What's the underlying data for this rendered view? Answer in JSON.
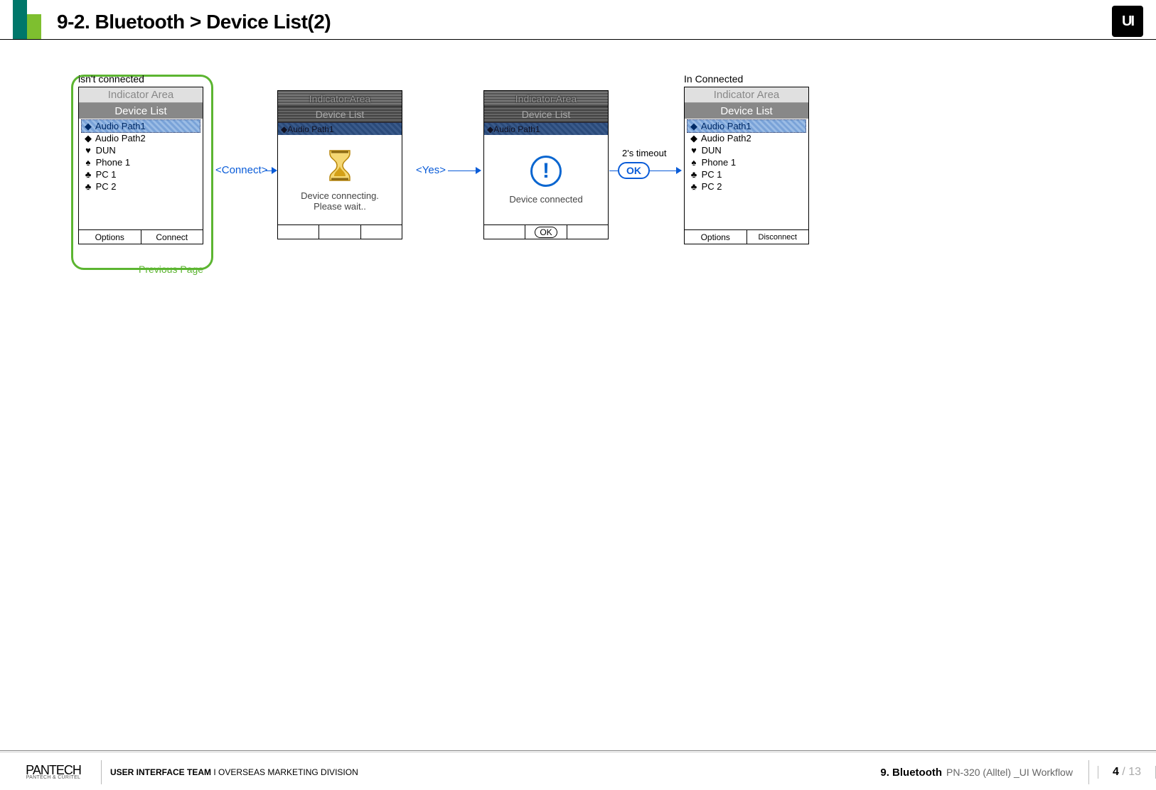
{
  "header": {
    "title": "9-2. Bluetooth > Device List(2)",
    "logo": "UI"
  },
  "flow": {
    "screen1": {
      "caption": "isn't connected",
      "indicator": "Indicator Area",
      "list_header": "Device List",
      "items": [
        {
          "sym": "◆",
          "label": "Audio Path1",
          "selected": true
        },
        {
          "sym": "◆",
          "label": "Audio Path2"
        },
        {
          "sym": "♥",
          "label": "DUN"
        },
        {
          "sym": "♠",
          "label": "Phone 1"
        },
        {
          "sym": "♣",
          "label": "PC 1"
        },
        {
          "sym": "♣",
          "label": "PC 2"
        }
      ],
      "sk_left": "Options",
      "sk_right": "Connect",
      "prev_page": "Previous Page"
    },
    "arrow1": "<Connect>",
    "screen2": {
      "grey_indicator": "Indicator Area",
      "grey_list_header": "Device List",
      "grey_row": "Audio Path1",
      "body_line1": "Device connecting.",
      "body_line2": "Please wait..",
      "sk_left": "",
      "sk_mid": "",
      "sk_right": ""
    },
    "arrow2": "<Yes>",
    "screen3": {
      "grey_indicator": "Indicator Area",
      "grey_list_header": "Device List",
      "grey_row": "Audio Path1",
      "alert_glyph": "!",
      "body": "Device connected",
      "sk_mid": "OK"
    },
    "ok_bubble": "OK",
    "timeout": "2's timeout",
    "screen4": {
      "caption": "In Connected",
      "indicator": "Indicator Area",
      "list_header": "Device List",
      "items": [
        {
          "sym": "◆",
          "label": "Audio Path1",
          "selected": true
        },
        {
          "sym": "◆",
          "label": "Audio Path2"
        },
        {
          "sym": "♥",
          "label": "DUN"
        },
        {
          "sym": "♠",
          "label": "Phone 1"
        },
        {
          "sym": "♣",
          "label": "PC 1"
        },
        {
          "sym": "♣",
          "label": "PC 2"
        }
      ],
      "sk_left": "Options",
      "sk_right": "Disconnect"
    }
  },
  "footer": {
    "brand": "PANTECH",
    "brand_sub": "PANTECH & CURITEL",
    "team_bold": "USER INTERFACE TEAM",
    "team_sep": "  I  ",
    "team_rest": "OVERSEAS MARKETING DIVISION",
    "section_num": "9. Bluetooth",
    "section_sub": "PN-320 (Alltel) _UI Workflow",
    "page_cur": "4",
    "page_sep": " / ",
    "page_tot": "13"
  }
}
